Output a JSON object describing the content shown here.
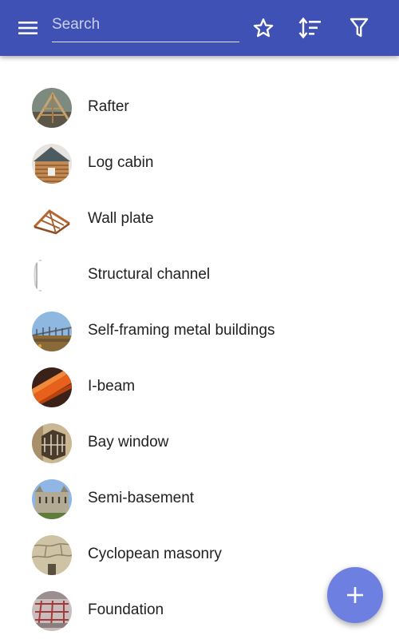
{
  "colors": {
    "toolbar": "#3f51b5",
    "fab": "#6d7fe0",
    "text": "#212121"
  },
  "toolbar": {
    "menu_icon": "hamburger-menu-icon",
    "search": {
      "placeholder": "Search",
      "value": ""
    },
    "actions": [
      {
        "icon": "star-outline-icon"
      },
      {
        "icon": "sort-icon"
      },
      {
        "icon": "filter-icon"
      }
    ]
  },
  "list": {
    "items": [
      {
        "label": "Rafter",
        "thumbnail": "rafter-photo"
      },
      {
        "label": "Log cabin",
        "thumbnail": "log-cabin-photo"
      },
      {
        "label": "Wall plate",
        "thumbnail": "wall-plate-photo"
      },
      {
        "label": "Structural channel",
        "thumbnail": "structural-channel-photo"
      },
      {
        "label": "Self-framing metal buildings",
        "thumbnail": "metal-building-photo"
      },
      {
        "label": "I-beam",
        "thumbnail": "i-beam-photo"
      },
      {
        "label": "Bay window",
        "thumbnail": "bay-window-photo"
      },
      {
        "label": "Semi-basement",
        "thumbnail": "semi-basement-photo"
      },
      {
        "label": "Cyclopean masonry",
        "thumbnail": "cyclopean-masonry-photo"
      },
      {
        "label": "Foundation",
        "thumbnail": "foundation-photo"
      }
    ]
  },
  "fab": {
    "icon": "plus-icon"
  }
}
